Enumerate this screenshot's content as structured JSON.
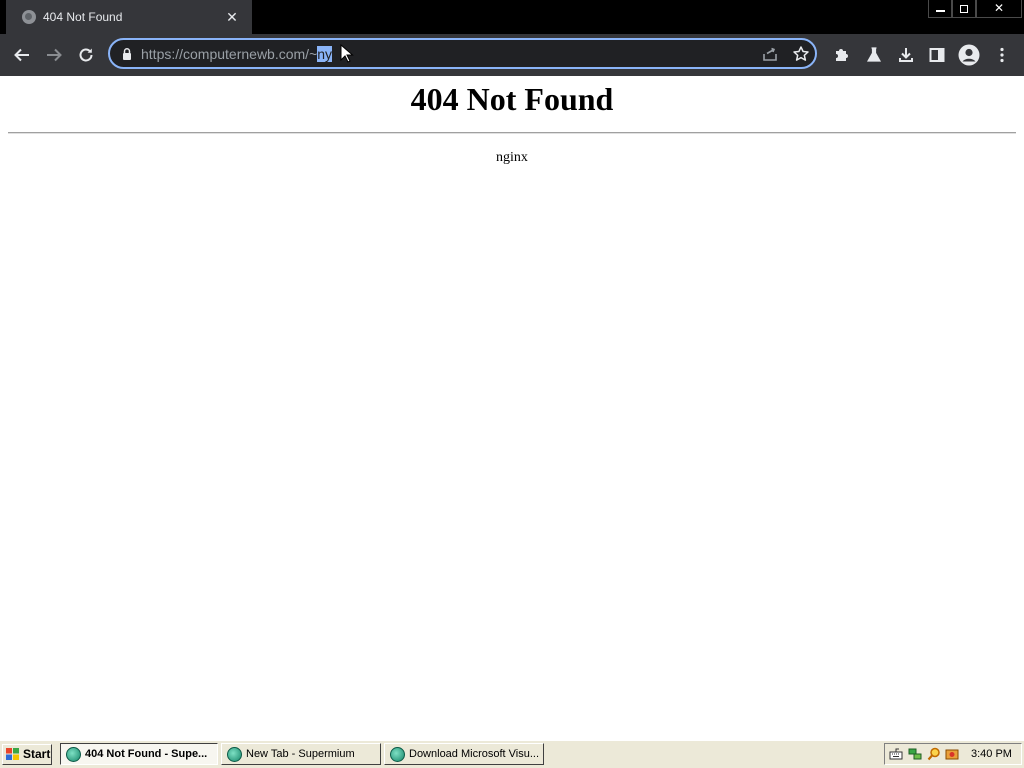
{
  "browser": {
    "tab": {
      "title": "404 Not Found"
    },
    "address_bar": {
      "url_main": "https://computernewb.com/",
      "url_dim": "~",
      "url_selected": "ny"
    }
  },
  "page": {
    "heading": "404 Not Found",
    "server": "nginx"
  },
  "taskbar": {
    "start_label": "Start",
    "tasks": [
      {
        "label": "404 Not Found - Supe...",
        "active": true
      },
      {
        "label": "New Tab - Supermium",
        "active": false
      },
      {
        "label": "Download Microsoft Visu...",
        "active": false
      }
    ],
    "clock": "3:40 PM"
  },
  "colors": {
    "tabstrip": "#000000",
    "toolbar": "#35363a",
    "omnibox_focus": "#8ab4f8",
    "taskbar": "#ece9d8"
  },
  "icons": {
    "tab_favicon": "globe-icon",
    "back": "back-arrow-icon",
    "forward": "forward-arrow-icon",
    "reload": "reload-icon",
    "lock": "lock-icon",
    "share": "share-icon",
    "bookmark": "star-icon",
    "extensions": "puzzle-icon",
    "labs": "flask-icon",
    "download": "download-icon",
    "side_panel": "side-panel-icon",
    "profile": "avatar-icon",
    "menu": "kebab-menu-icon"
  }
}
